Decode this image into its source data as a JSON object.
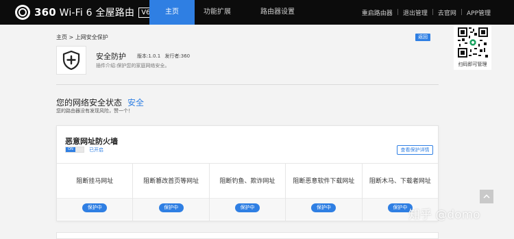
{
  "header": {
    "brand_number": "360",
    "brand_text": "Wi-Fi 6 全屋路由",
    "version_badge": "V6",
    "tabs": [
      {
        "label": "主页"
      },
      {
        "label": "功能扩展"
      },
      {
        "label": "路由器设置"
      }
    ],
    "links": [
      "重启路由器",
      "退出管理",
      "去官网",
      "APP管理"
    ]
  },
  "breadcrumb": {
    "home": "主页",
    "separator": ">",
    "current": "上网安全保护"
  },
  "back_button": "返回",
  "plugin": {
    "icon": "shield-plus-icon",
    "title": "安全防护",
    "version": "版本:1.0.1",
    "publisher": "发行者:360",
    "description": "插件介绍:保护您的家庭网络安全。"
  },
  "status": {
    "label": "您的网络安全状态",
    "value": "安全",
    "subtext": "您的路由器没有发现风险，赞一个！"
  },
  "firewall": {
    "title": "恶意网址防火墙",
    "toggle_label": "ON",
    "toggle_state": "已开启",
    "detail_button": "查看保护详情",
    "items": [
      {
        "label": "阻断挂马网址",
        "status": "保护中"
      },
      {
        "label": "阻断篡改首页等网址",
        "status": "保护中"
      },
      {
        "label": "阻断钓鱼、欺诈网址",
        "status": "保护中"
      },
      {
        "label": "阻断恶意软件下载网址",
        "status": "保护中"
      },
      {
        "label": "阻断木马、下载者网址",
        "status": "保护中"
      }
    ]
  },
  "qr": {
    "caption": "扫码即可管理",
    "icon": "qr-code-icon"
  },
  "scroll_top": {
    "icon": "chevron-up-icon"
  },
  "watermark": "知乎 @domo",
  "colors": {
    "accent": "#2f7fe3",
    "topbar": "#0c0c0c"
  }
}
